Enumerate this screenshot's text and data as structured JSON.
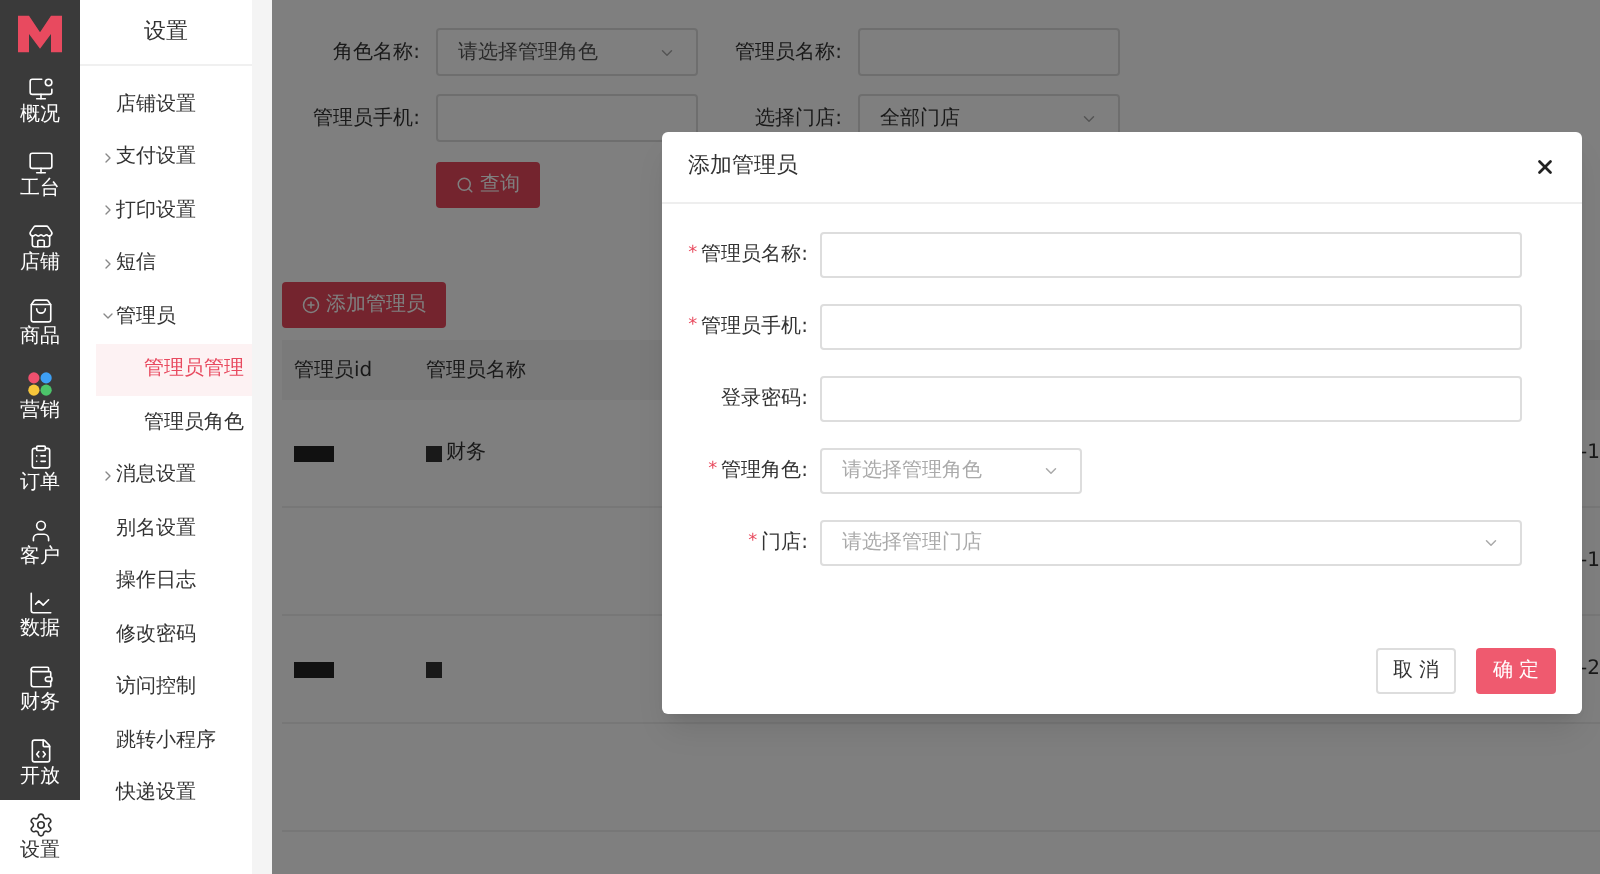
{
  "rail": [
    {
      "label": "概况",
      "selected": false
    },
    {
      "label": "工台",
      "selected": false
    },
    {
      "label": "店铺",
      "selected": false
    },
    {
      "label": "商品",
      "selected": false
    },
    {
      "label": "营销",
      "selected": false
    },
    {
      "label": "订单",
      "selected": false
    },
    {
      "label": "客户",
      "selected": false
    },
    {
      "label": "数据",
      "selected": false
    },
    {
      "label": "财务",
      "selected": false
    },
    {
      "label": "开放",
      "selected": false
    },
    {
      "label": "设置",
      "selected": true
    }
  ],
  "submenu": {
    "title": "设置",
    "items": [
      {
        "label": "店铺设置",
        "kind": "link",
        "selected": false
      },
      {
        "label": "支付设置",
        "kind": "group",
        "expanded": false,
        "selected": false
      },
      {
        "label": "打印设置",
        "kind": "group",
        "expanded": false,
        "selected": false
      },
      {
        "label": "短信",
        "kind": "group",
        "expanded": false,
        "selected": false
      },
      {
        "label": "管理员",
        "kind": "group",
        "expanded": true,
        "selected": false,
        "children": [
          {
            "label": "管理员管理",
            "selected": true
          },
          {
            "label": "管理员角色",
            "selected": false
          }
        ]
      },
      {
        "label": "消息设置",
        "kind": "group",
        "expanded": false,
        "selected": false
      },
      {
        "label": "别名设置",
        "kind": "link",
        "selected": false
      },
      {
        "label": "操作日志",
        "kind": "link",
        "selected": false
      },
      {
        "label": "修改密码",
        "kind": "link",
        "selected": false
      },
      {
        "label": "访问控制",
        "kind": "link",
        "selected": false
      },
      {
        "label": "跳转小程序",
        "kind": "link",
        "selected": false
      },
      {
        "label": "快递设置",
        "kind": "link",
        "selected": false
      }
    ]
  },
  "filters": [
    {
      "label": "角色名称:",
      "kind": "select",
      "placeholder": "请选择管理角色"
    },
    {
      "label": "管理员名称:",
      "kind": "input"
    },
    {
      "label": "管理员手机:",
      "kind": "input"
    },
    {
      "label": "选择门店:",
      "kind": "select",
      "value": "全部门店"
    }
  ],
  "query_button": "查询",
  "add_button": "添加管理员",
  "table": {
    "columns": [
      "管理员id",
      "管理员名称"
    ],
    "rows": [
      {
        "redacted": true,
        "name": "财务",
        "trailing": "-1"
      },
      {
        "redacted": false,
        "trailing": "-1"
      },
      {
        "redacted": true,
        "trailing": "-2"
      },
      {
        "redacted": false
      }
    ]
  },
  "dialog": {
    "title": "添加管理员",
    "required_marker": "*",
    "fields": [
      {
        "label": "管理员名称:",
        "required": true,
        "kind": "input",
        "wide": true
      },
      {
        "label": "管理员手机:",
        "required": true,
        "kind": "input",
        "wide": true
      },
      {
        "label": "登录密码:",
        "required": false,
        "kind": "input",
        "wide": true
      },
      {
        "label": "管理角色:",
        "required": true,
        "kind": "select",
        "wide": false,
        "placeholder": "请选择管理角色"
      },
      {
        "label": "门店:",
        "required": true,
        "kind": "select",
        "wide": true,
        "placeholder": "请选择管理门店"
      }
    ],
    "buttons": [
      {
        "label": "取消",
        "kind": "secondary"
      },
      {
        "label": "确定",
        "kind": "primary"
      }
    ]
  }
}
